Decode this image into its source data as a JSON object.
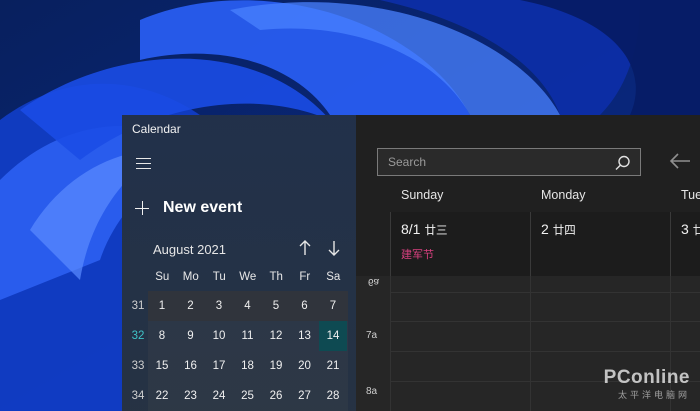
{
  "app": {
    "title": "Calendar"
  },
  "sidebar": {
    "new_event_label": "New event",
    "month_label": "August 2021",
    "weekdays": [
      "Su",
      "Mo",
      "Tu",
      "We",
      "Th",
      "Fr",
      "Sa"
    ],
    "weeks": [
      {
        "num": "31",
        "days": [
          "1",
          "2",
          "3",
          "4",
          "5",
          "6",
          "7"
        ]
      },
      {
        "num": "32",
        "days": [
          "8",
          "9",
          "10",
          "11",
          "12",
          "13",
          "14"
        ]
      },
      {
        "num": "33",
        "days": [
          "15",
          "16",
          "17",
          "18",
          "19",
          "20",
          "21"
        ]
      },
      {
        "num": "34",
        "days": [
          "22",
          "23",
          "24",
          "25",
          "26",
          "27",
          "28"
        ]
      }
    ],
    "current_week": "32",
    "today": "14"
  },
  "toolbar": {
    "search_placeholder": "Search"
  },
  "week_view": {
    "day_headers": [
      "Sunday",
      "Monday",
      "Tue"
    ],
    "days": [
      {
        "date": "8/1",
        "lunar": "廿三",
        "holiday": "建军节"
      },
      {
        "date": "2",
        "lunar": "廿四",
        "holiday": ""
      },
      {
        "date": "3",
        "lunar": "廿",
        "holiday": ""
      }
    ],
    "hours": [
      "6a",
      "7a",
      "8a"
    ]
  },
  "watermark": {
    "logo": "PConline",
    "sub": "太平洋电脑网"
  },
  "colors": {
    "accent_today": "#0e4a52",
    "week_current": "#3fc3c7",
    "holiday": "#d8407f"
  }
}
